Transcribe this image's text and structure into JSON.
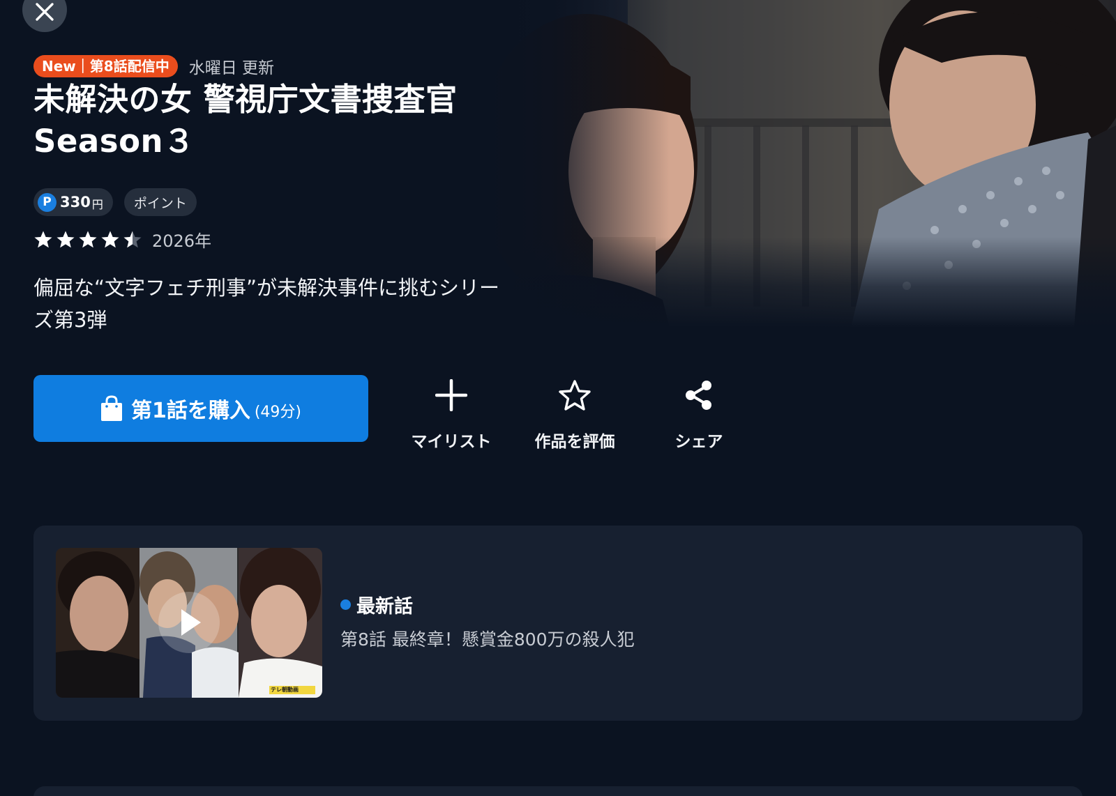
{
  "header": {
    "badge": "New｜第8話配信中",
    "update_day": "水曜日 更新",
    "title": "未解決の女 警視庁文書捜査官 Season３"
  },
  "pricing": {
    "point_icon": "P",
    "price": "330",
    "unit": "円",
    "method": "ポイント"
  },
  "rating": {
    "value": 4.5,
    "max": 5,
    "year": "2026年"
  },
  "tagline": "偏屈な“文字フェチ刑事”が未解決事件に挑むシリーズ第3弾",
  "actions": {
    "buy_label": "第1話を購入",
    "buy_duration": "(49分)",
    "mylist": "マイリスト",
    "rate": "作品を評価",
    "share": "シェア"
  },
  "latest_episode": {
    "label": "最新話",
    "title": "第8話 最終章！懸賞金800万の殺人犯",
    "thumb_watermark": "テレ朝動画"
  },
  "colors": {
    "background": "#0b1321",
    "card": "#172030",
    "accent_blue": "#0f7de0",
    "badge_red": "#ea4d1d"
  },
  "icons": {
    "close": "close-icon",
    "bag": "shopping-bag-icon",
    "plus": "plus-icon",
    "star": "star-outline-icon",
    "share": "share-icon",
    "play": "play-icon"
  }
}
